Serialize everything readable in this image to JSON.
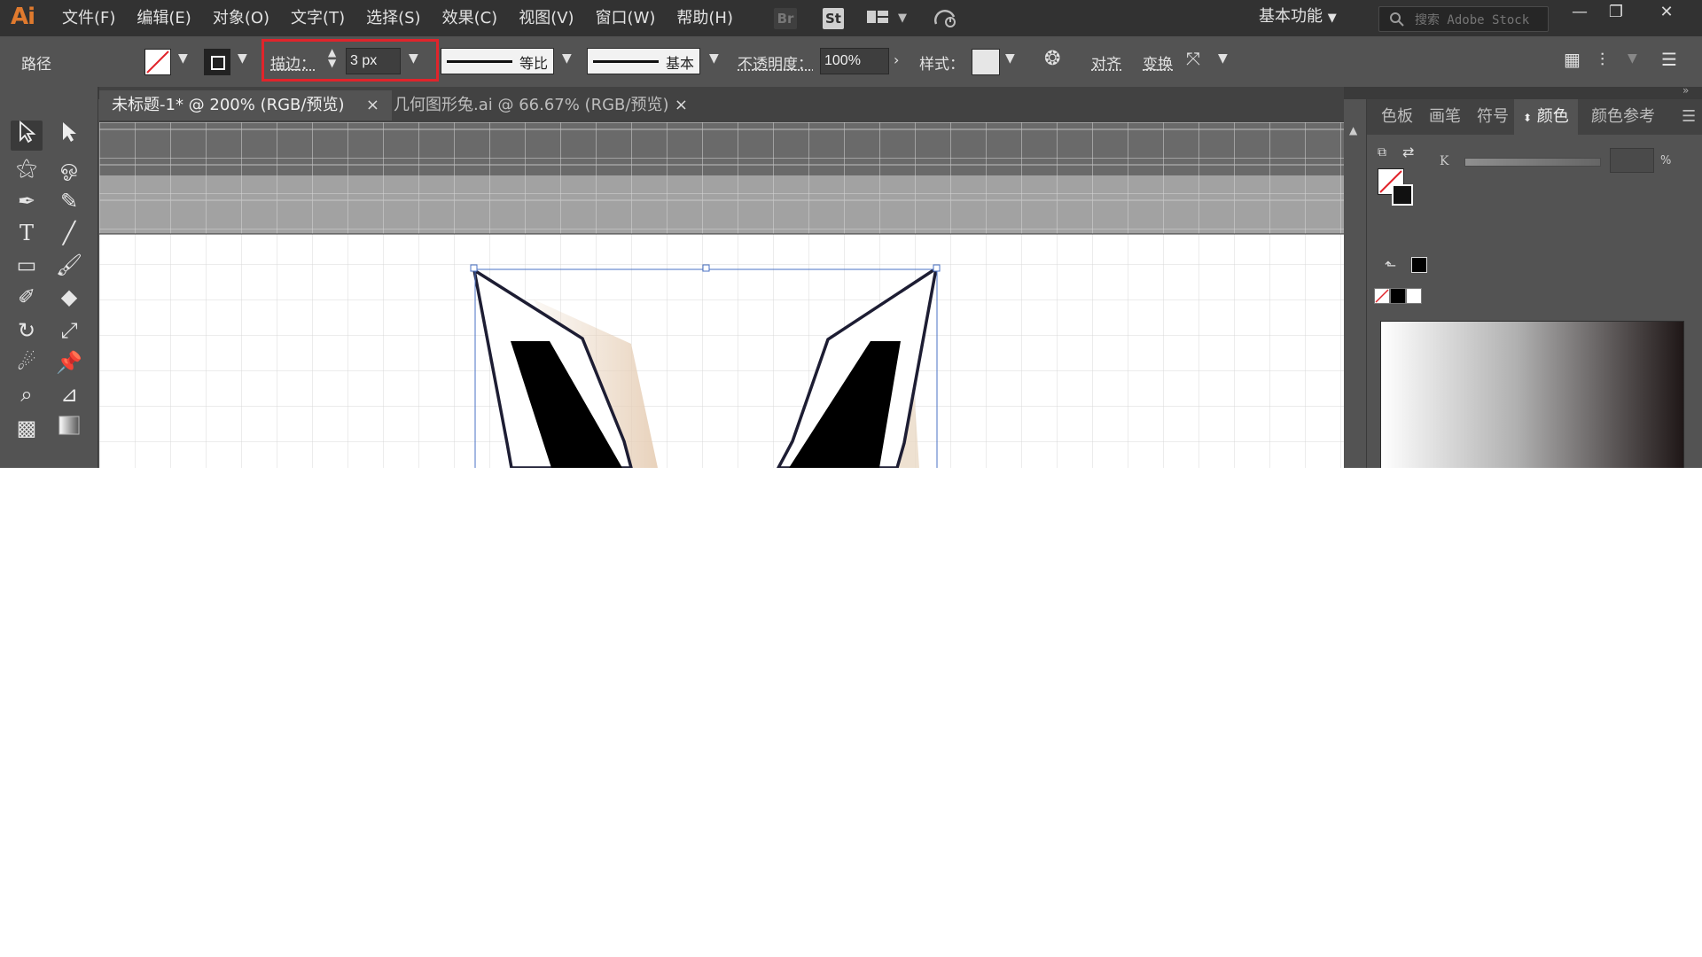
{
  "app": {
    "logo": "Ai",
    "menu": [
      {
        "label": "文件(F)"
      },
      {
        "label": "编辑(E)"
      },
      {
        "label": "对象(O)"
      },
      {
        "label": "文字(T)"
      },
      {
        "label": "选择(S)"
      },
      {
        "label": "效果(C)"
      },
      {
        "label": "视图(V)"
      },
      {
        "label": "窗口(W)"
      },
      {
        "label": "帮助(H)"
      }
    ],
    "bridge_label": "Br",
    "stock_label": "St",
    "workspace": "基本功能",
    "search_placeholder": "搜索 Adobe Stock"
  },
  "control_bar": {
    "selection_type": "路径",
    "stroke_label": "描边：",
    "stroke_value": "3 px",
    "profile_label": "等比",
    "brush_label": "基本",
    "opacity_label": "不透明度：",
    "opacity_value": "100%",
    "style_label": "样式：",
    "align_label": "对齐",
    "transform_label": "变换"
  },
  "tabs": [
    {
      "label": "未标题-1* @ 200% (RGB/预览)",
      "active": true
    },
    {
      "label": "几何图形兔.ai @ 66.67% (RGB/预览)",
      "active": false
    }
  ],
  "right_panel": {
    "tabs": [
      {
        "label": "色板"
      },
      {
        "label": "画笔"
      },
      {
        "label": "符号"
      },
      {
        "label": "颜色"
      },
      {
        "label": "颜色参考"
      }
    ],
    "active_tab": "颜色",
    "channel_label": "K",
    "percent_label": "%"
  },
  "colors": {
    "accent_highlight": "#e1242b",
    "app_bg": "#535353",
    "menubar_bg": "#323232",
    "logo": "#e07a2e",
    "selection_bbox": "#4a72c4"
  }
}
